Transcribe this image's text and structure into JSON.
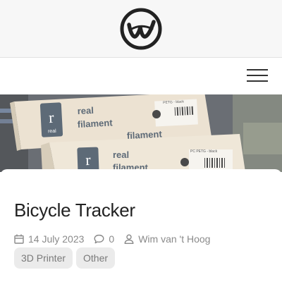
{
  "header": {
    "logo_icon": "w-circle-logo-icon",
    "menu_icon": "hamburger-menu-icon"
  },
  "hero": {
    "image_subject": "Boxes of real filament PETG spools on a desk",
    "box_text_1": "real",
    "box_text_2": "filament",
    "box_badge": "real",
    "label_1": "PETG - black",
    "label_2": "PC PETG - black"
  },
  "post": {
    "title": "Bicycle Tracker",
    "date": "14 July 2023",
    "comments": "0",
    "author": "Wim van 't Hoog",
    "tags": [
      "3D Printer",
      "Other"
    ]
  },
  "colors": {
    "header_bg": "#f7f7f7",
    "meta_text": "#8a8a8a",
    "tag_bg": "#ebebeb"
  }
}
